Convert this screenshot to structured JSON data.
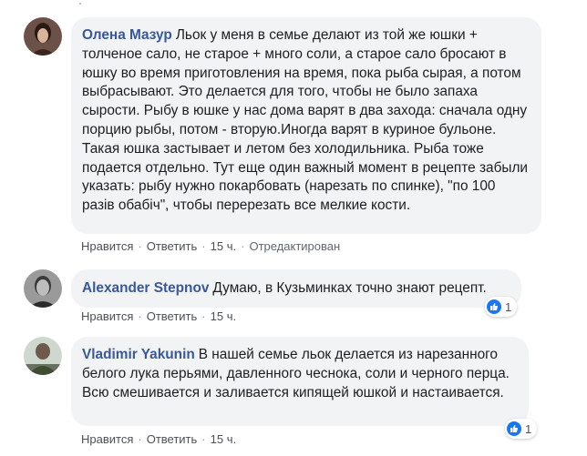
{
  "comments": [
    {
      "author": "Олена Мазур",
      "text": "Льок у меня в семье делают из той же юшки + толченое сало, не старое + много соли, а старое сало бросают в юшку во время приготовления на время, пока рыба сырая, а потом выбрасывают. Это делается для того, чтобы не было запаха сырости. Рыбу в юшке у нас дома варят в два захода: сначала одну порцию рыбы, потом - вторую.Иногда варят в куриное бульоне. Такая юшка застывает и летом без холодильника. Рыба тоже подается отдельно. Тут еще один важный момент в рецепте забыли указать: рыбу нужно покарбовать (нарезать по спинке), \"по 100 разів обабіч\", чтобы перерезать все мелкие кости.",
      "like_label": "Нравится",
      "reply_label": "Ответить",
      "time": "15 ч.",
      "edited": "Отредактирован"
    },
    {
      "author": "Alexander Stepnov",
      "text": "Думаю, в Кузьминках точно знают рецепт.",
      "like_label": "Нравится",
      "reply_label": "Ответить",
      "time": "15 ч.",
      "reaction_count": "1"
    },
    {
      "author": "Vladimir Yakunin",
      "text": "В нашей семье льок делается из нарезанного белого лука перьями, давленного чеснока, соли и черного перца. Всю смешивается и заливается кипящей юшкой и настаивается.",
      "like_label": "Нравится",
      "reply_label": "Ответить",
      "time": "15 ч.",
      "reaction_count": "1"
    }
  ],
  "icons": {
    "reaction": "like-thumb-icon"
  },
  "colors": {
    "author": "#385898",
    "bubble": "#f2f3f5",
    "like": "#1877f2"
  }
}
